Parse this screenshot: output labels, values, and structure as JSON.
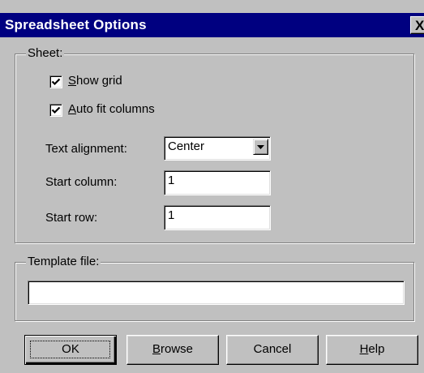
{
  "window": {
    "title": "Spreadsheet Options",
    "close_glyph": "X"
  },
  "sheet_group": {
    "label": "Sheet:",
    "show_grid": {
      "access_key": "S",
      "label_rest": "how grid",
      "checked": true
    },
    "auto_fit": {
      "access_key": "A",
      "label_rest": "uto fit columns",
      "checked": true
    },
    "text_alignment": {
      "label": "Text alignment:",
      "value": "Center"
    },
    "start_column": {
      "label": "Start column:",
      "value": "1"
    },
    "start_row": {
      "label": "Start row:",
      "value": "1"
    }
  },
  "template_group": {
    "label": "Template file:",
    "value": ""
  },
  "buttons": {
    "ok": "OK",
    "browse_key": "B",
    "browse_rest": "rowse",
    "cancel": "Cancel",
    "help_key": "H",
    "help_rest": "elp"
  },
  "icons": {
    "close": "close-icon",
    "check": "checkmark-icon",
    "dropdown": "chevron-down-icon"
  },
  "colors": {
    "titlebar": "#000080",
    "face": "#c0c0c0"
  }
}
